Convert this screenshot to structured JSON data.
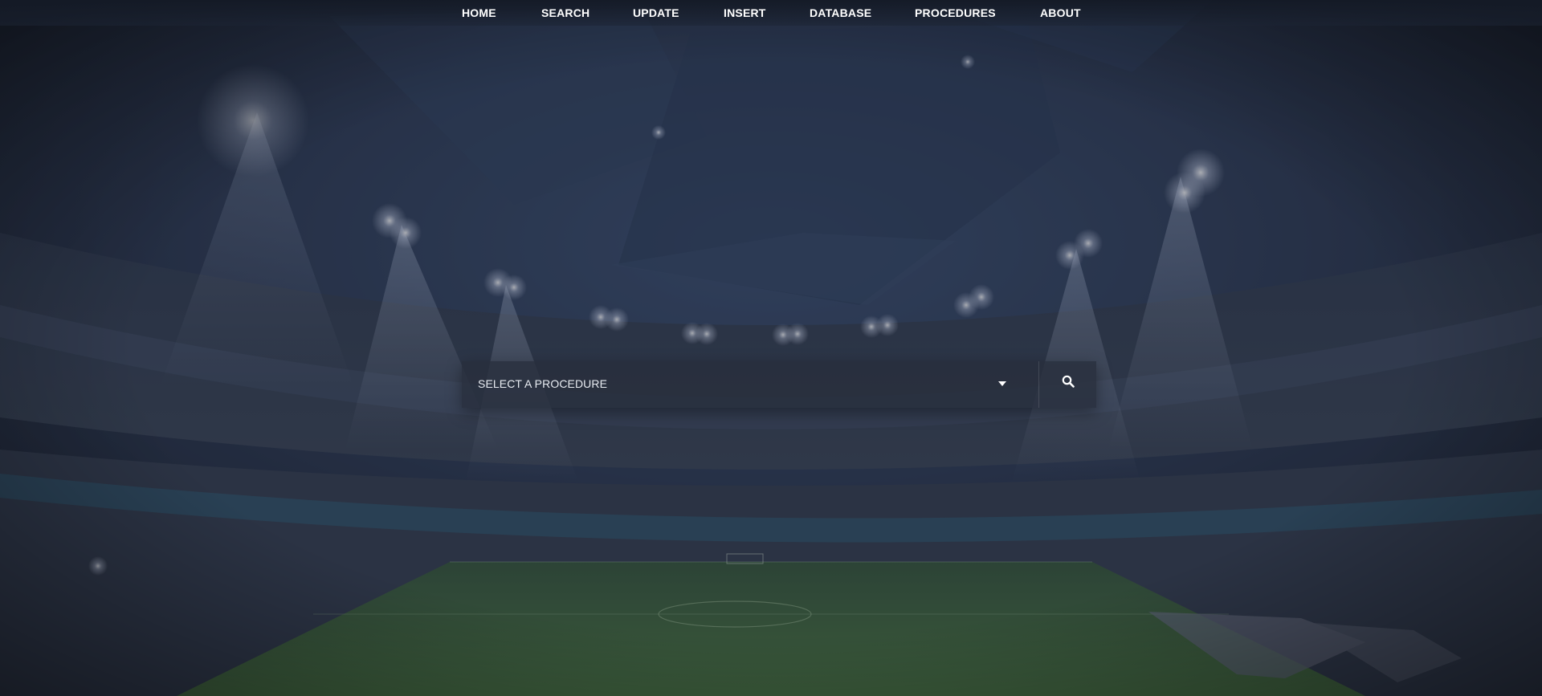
{
  "nav": {
    "items": [
      {
        "label": "HOME"
      },
      {
        "label": "SEARCH"
      },
      {
        "label": "UPDATE"
      },
      {
        "label": "INSERT"
      },
      {
        "label": "DATABASE"
      },
      {
        "label": "PROCEDURES"
      },
      {
        "label": "ABOUT"
      }
    ]
  },
  "procedure_select": {
    "selected": "SELECT A PROCEDURE",
    "caret_icon": "caret-down-icon"
  },
  "search_button": {
    "icon": "search-icon"
  },
  "colors": {
    "overlay": "#1c2230",
    "pitch": "#3f6a3a",
    "nav_text": "#ffffff"
  }
}
